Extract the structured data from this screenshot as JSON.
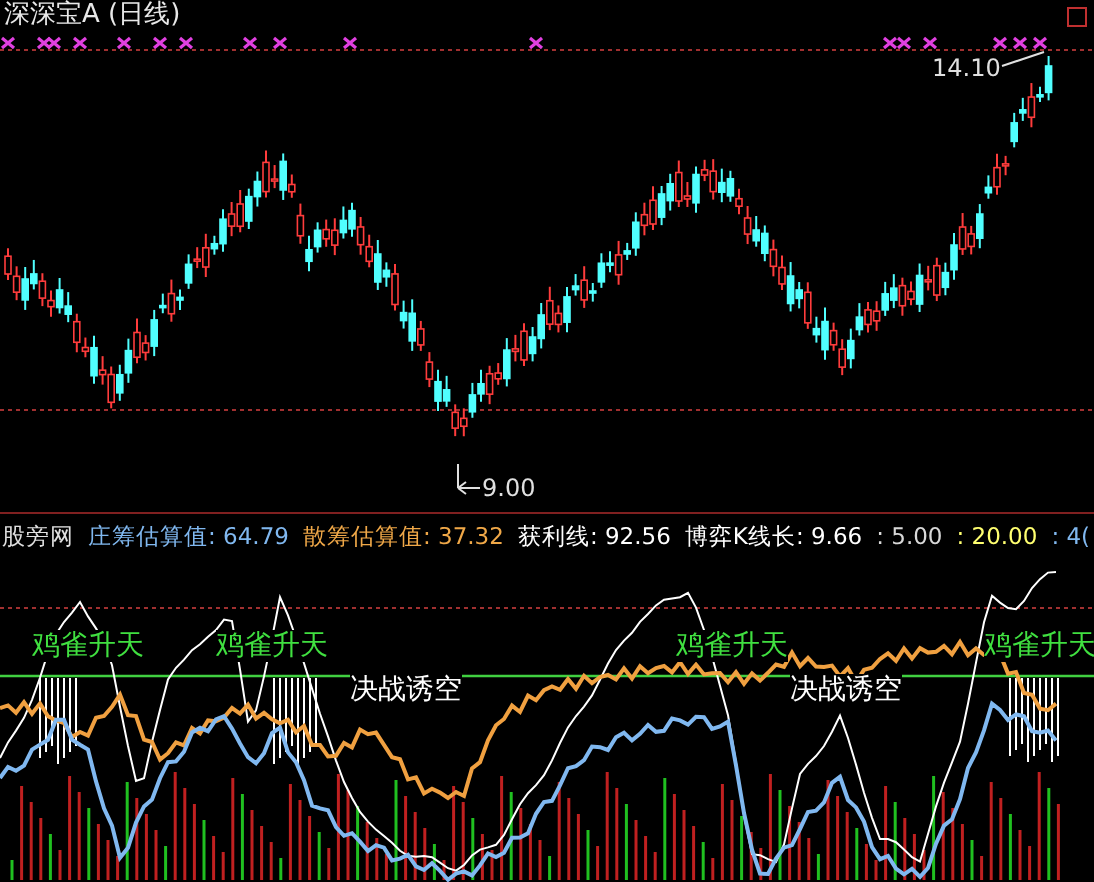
{
  "title": "深深宝A (日线)",
  "price_chart": {
    "high_label": "14.10",
    "low_label": "9.00"
  },
  "indicator": {
    "name": "股旁网",
    "values": [
      {
        "label": "庄筹估算值:",
        "value": "64.79",
        "color": "#80b8f0"
      },
      {
        "label": "散筹估算值:",
        "value": "37.32",
        "color": "#f0a848"
      },
      {
        "label": "获利线:",
        "value": "92.56",
        "color": "#ffffff"
      },
      {
        "label": "博弈K线长:",
        "value": "9.66",
        "color": "#ffffff"
      },
      {
        "label": ":",
        "value": "5.00",
        "color": "#d8d8d8"
      },
      {
        "label": ":",
        "value": "20.00",
        "color": "#ffff70"
      },
      {
        "label": ":",
        "value": "4(",
        "color": "#80b8f0"
      }
    ]
  },
  "signals": [
    {
      "kind": "rise",
      "text": "鸡雀升天"
    },
    {
      "kind": "rise",
      "text": "鸡雀升天"
    },
    {
      "kind": "trap",
      "text": "决战诱空"
    },
    {
      "kind": "rise",
      "text": "鸡雀升天"
    },
    {
      "kind": "trap",
      "text": "决战诱空"
    },
    {
      "kind": "rise",
      "text": "鸡雀升天"
    }
  ]
}
